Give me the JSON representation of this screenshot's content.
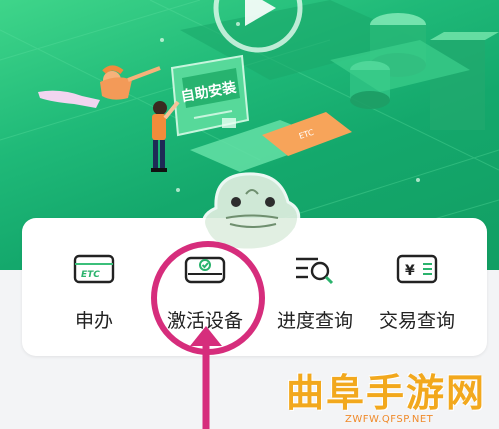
{
  "banner": {
    "sign_text": "自助安装",
    "etc_card_text": "ETC",
    "colors": {
      "green_light": "#3fd58a",
      "green_dark": "#129e63",
      "orange": "#f7a45a"
    }
  },
  "menu": {
    "items": [
      {
        "label": "申办",
        "icon": "etc-card-icon"
      },
      {
        "label": "激活设备",
        "icon": "device-check-icon"
      },
      {
        "label": "进度查询",
        "icon": "list-search-icon"
      },
      {
        "label": "交易查询",
        "icon": "yen-card-icon"
      }
    ]
  },
  "annotation": {
    "color": "#d62d7c",
    "highlighted": "激活设备"
  },
  "watermark": {
    "title": "曲阜手游网",
    "url": "ZWFW.QFSP.NET",
    "color": "#f2a81d"
  }
}
